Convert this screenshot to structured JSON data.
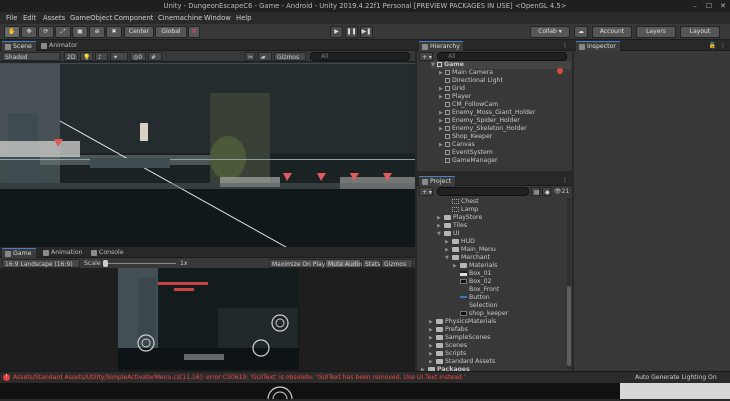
{
  "window": {
    "title": "Unity - DungeonEscapeC6 - Game - Android - Unity 2019.4.22f1 Personal [PREVIEW PACKAGES IN USE] <OpenGL 4.5>",
    "min": "–",
    "max": "☐",
    "close": "✕"
  },
  "menu": [
    "File",
    "Edit",
    "Assets",
    "GameObject",
    "Component",
    "Cinemachine",
    "Window",
    "Help"
  ],
  "toolbar": {
    "pivot": "Center",
    "space": "Global",
    "collab": "Collab ▾",
    "account": "Account",
    "layers": "Layers",
    "layout": "Layout"
  },
  "scene_panel": {
    "tabs": [
      "Scene",
      "Animator"
    ],
    "shading": "Shaded",
    "mode2d": "2D",
    "gizmos": "Gizmos",
    "search_placeholder": "All",
    "hidden_count": "0"
  },
  "game_panel": {
    "tabs": [
      "Game",
      "Animation",
      "Console"
    ],
    "resolution": "16:9 Landscape (16:9)",
    "scale_label": "Scale",
    "scale_value": "1x",
    "maximize": "Maximize On Play",
    "mute": "Mute Audio",
    "stats": "Stats",
    "gizmos": "Gizmos"
  },
  "hierarchy": {
    "tab": "Hierarchy",
    "add": "+ ▾",
    "search_placeholder": "All",
    "scene": "Game",
    "items": [
      "Main Camera",
      "Directional Light",
      "Grid",
      "Player",
      "CM_FollowCam",
      "Enemy_Moss_Giant_Holder",
      "Enemy_Spider_Holder",
      "Enemy_Skeleton_Holder",
      "Shop_Keeper",
      "Canvas",
      "EventSystem",
      "GameManager"
    ]
  },
  "inspector": {
    "tab": "Inspector"
  },
  "project": {
    "tab": "Project",
    "add": "+ ▾",
    "count": "21",
    "items": [
      {
        "label": "Chest",
        "depth": 3,
        "kind": "prefab"
      },
      {
        "label": "Lamp",
        "depth": 3,
        "kind": "prefab"
      },
      {
        "label": "PlayStore",
        "depth": 2,
        "kind": "folder"
      },
      {
        "label": "Tiles",
        "depth": 2,
        "kind": "folder"
      },
      {
        "label": "UI",
        "depth": 2,
        "kind": "folder",
        "open": true
      },
      {
        "label": "HUD",
        "depth": 3,
        "kind": "folder"
      },
      {
        "label": "Main_Menu",
        "depth": 3,
        "kind": "folder"
      },
      {
        "label": "Merchant",
        "depth": 3,
        "kind": "folder",
        "open": true
      },
      {
        "label": "Materials",
        "depth": 4,
        "kind": "folder"
      },
      {
        "label": "Box_01",
        "depth": 4,
        "kind": "sprite"
      },
      {
        "label": "Box_02",
        "depth": 4,
        "kind": "black"
      },
      {
        "label": "Box_Front",
        "depth": 4,
        "kind": "none"
      },
      {
        "label": "Button",
        "depth": 4,
        "kind": "blue"
      },
      {
        "label": "Selection",
        "depth": 4,
        "kind": "none"
      },
      {
        "label": "shop_keeper",
        "depth": 4,
        "kind": "black"
      },
      {
        "label": "PhysicsMaterials",
        "depth": 1,
        "kind": "folder"
      },
      {
        "label": "Prefabs",
        "depth": 1,
        "kind": "folder"
      },
      {
        "label": "SampleScenes",
        "depth": 1,
        "kind": "folder"
      },
      {
        "label": "Scenes",
        "depth": 1,
        "kind": "folder"
      },
      {
        "label": "Scripts",
        "depth": 1,
        "kind": "folder"
      },
      {
        "label": "Standard Assets",
        "depth": 1,
        "kind": "folder"
      },
      {
        "label": "Packages",
        "depth": 0,
        "kind": "folder",
        "bold": true
      }
    ]
  },
  "status": {
    "error": "Assets/Standard Assets/Utility/SimpleActivatorMenu.cs(11,16): error CS0619: 'GUIText' is obsolete: 'GUIText has been removed. Use UI.Text instead.'",
    "lighting": "Auto Generate Lighting On"
  },
  "colors": {
    "accent": "#4a7bc8",
    "error": "#e04040",
    "error_text": "#f04848"
  }
}
